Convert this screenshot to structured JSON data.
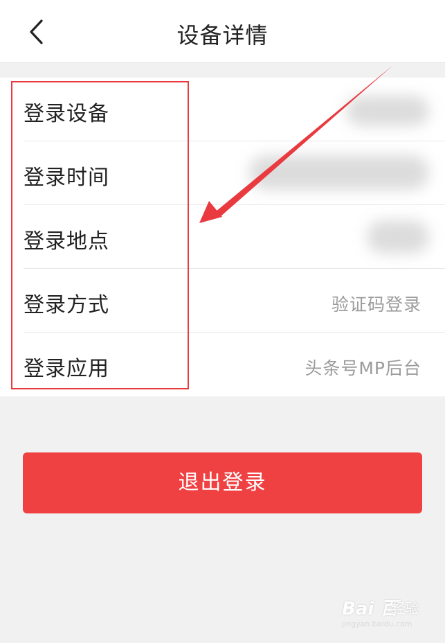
{
  "header": {
    "title": "设备详情",
    "back_icon": "chevron-left-icon"
  },
  "rows": [
    {
      "label": "登录设备",
      "value": ""
    },
    {
      "label": "登录时间",
      "value": ""
    },
    {
      "label": "登录地点",
      "value": ""
    },
    {
      "label": "登录方式",
      "value": "验证码登录"
    },
    {
      "label": "登录应用",
      "value": "头条号MP后台"
    }
  ],
  "logout_button": {
    "label": "退出登录"
  },
  "watermark": {
    "logo": "Bai 百",
    "text": "经验",
    "url": "jingyan.baidu.com"
  },
  "colors": {
    "accent": "#f04142",
    "annotation": "#e83a3f",
    "background": "#f1f1f1",
    "label_text": "#222222",
    "value_text": "#9b9b9b"
  }
}
